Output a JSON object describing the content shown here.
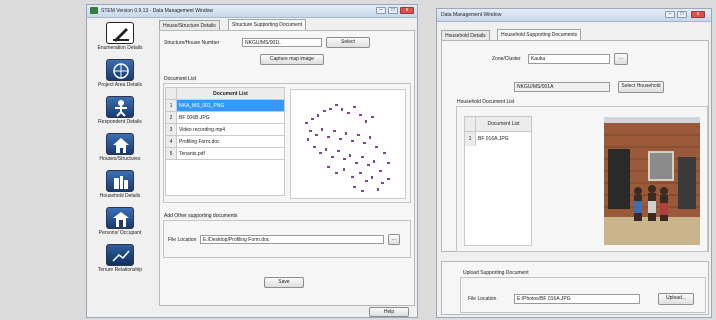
{
  "left_window": {
    "title": "STEM Version 0.9.13 - Data Management Window",
    "sidebar": [
      {
        "label": "Enumeration Details",
        "icon": "pen-icon"
      },
      {
        "label": "Project Area Details",
        "icon": "globe-icon"
      },
      {
        "label": "Respondent Details",
        "icon": "person-icon"
      },
      {
        "label": "Houses/Structures",
        "icon": "house-icon"
      },
      {
        "label": "Household Details",
        "icon": "household-icon"
      },
      {
        "label": "Persons/ Occupant",
        "icon": "door-icon"
      },
      {
        "label": "Tenure Relationship",
        "icon": "tenure-icon"
      }
    ],
    "tabs": [
      "House/Structure Details",
      "Structure Supporting Document"
    ],
    "structure_label": "Structure/House Number",
    "structure_value": "NKGU/MS/001L",
    "select_label": "Select",
    "capture_label": "Capture map image",
    "document_list_group": "Document List",
    "document_list_header": "Document List",
    "documents": [
      {
        "num": "1",
        "name": "NKA_MS_001_PNG"
      },
      {
        "num": "2",
        "name": "BF 006B.JPG"
      },
      {
        "num": "3",
        "name": "Video recording.mp4"
      },
      {
        "num": "4",
        "name": "Profiling Form.doc"
      },
      {
        "num": "5",
        "name": "Tenants.pdf"
      }
    ],
    "add_other_group": "Add Other supporting documents",
    "file_location_label": "File Location",
    "file_location_value": "E:/Desktop/Profiling Form.doc",
    "browse_label": "...",
    "save_label": "Save",
    "help_label": "Help"
  },
  "right_window": {
    "title": "Data Management Window",
    "tabs": [
      "Household Details",
      "Household Supporting Documents"
    ],
    "zone_label": "Zone/Cluster",
    "zone_value": "Kauka",
    "zone_browse": "...",
    "household_id_value": "NKGU/MS/001A",
    "select_household_label": "Select Household",
    "household_doc_group": "Household Document List",
    "household_doc_header": "Document List",
    "household_docs": [
      {
        "num": "1",
        "name": "BF 016A.JPG"
      }
    ],
    "upload_group": "Upload Supporting Document",
    "file_location_label": "File Location",
    "file_location_value": "E:/Photos/BF 016A.JPG",
    "upload_label": "Upload..."
  },
  "colors": {
    "accent_blue": "#3b6fb5",
    "selected_row": "#3399ff",
    "close_red": "#d9534f"
  }
}
